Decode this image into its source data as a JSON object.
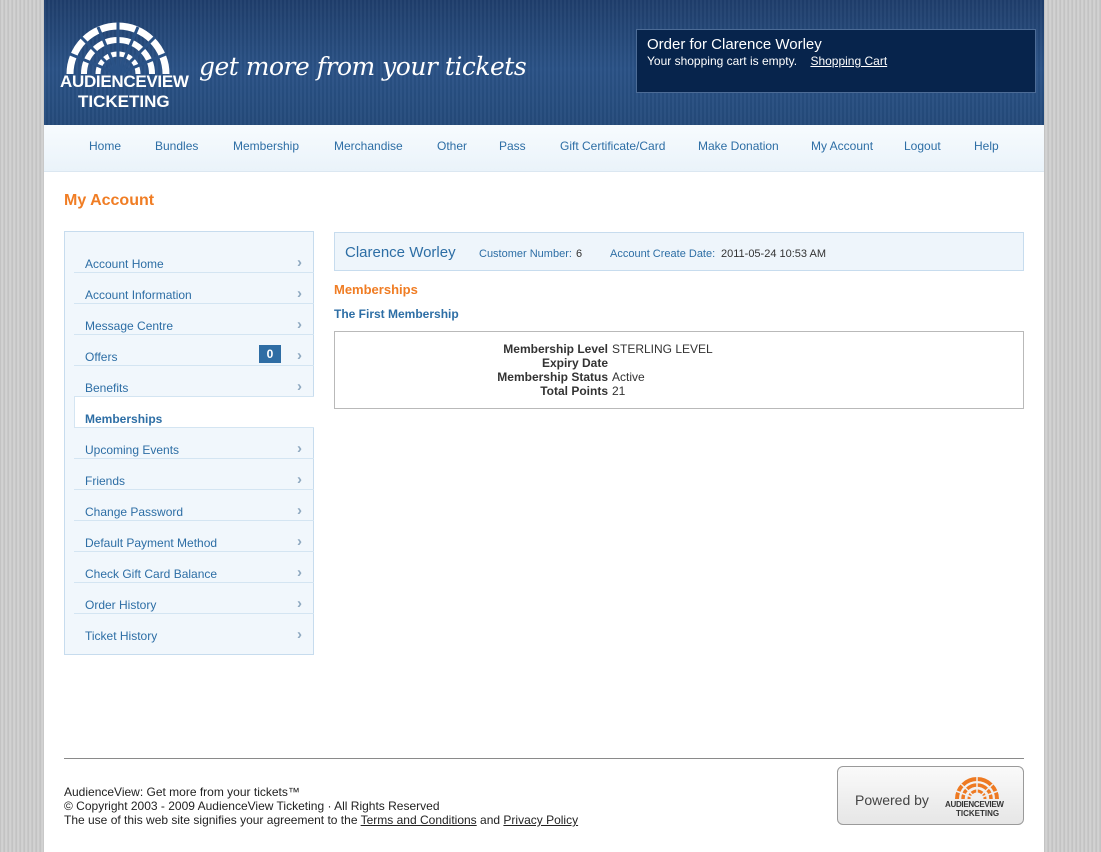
{
  "header": {
    "logo_line1": "AUDIENCEVIEW",
    "logo_line2": "TICKETING",
    "tagline": "get more from your tickets",
    "order_title": "Order for Clarence Worley",
    "cart_status": "Your shopping cart is empty.",
    "cart_link": "Shopping Cart"
  },
  "nav": {
    "items": [
      "Home",
      "Bundles",
      "Membership",
      "Merchandise",
      "Other",
      "Pass",
      "Gift Certificate/Card",
      "Make Donation",
      "My Account",
      "Logout",
      "Help"
    ]
  },
  "page_title": "My Account",
  "sidebar": {
    "items": [
      {
        "label": "Account Home"
      },
      {
        "label": "Account Information"
      },
      {
        "label": "Message Centre"
      },
      {
        "label": "Offers",
        "badge": "0"
      },
      {
        "label": "Benefits"
      },
      {
        "label": "Memberships",
        "active": true
      },
      {
        "label": "Upcoming Events"
      },
      {
        "label": "Friends"
      },
      {
        "label": "Change Password"
      },
      {
        "label": "Default Payment Method"
      },
      {
        "label": "Check Gift Card Balance"
      },
      {
        "label": "Order History"
      },
      {
        "label": "Ticket History"
      }
    ]
  },
  "customer": {
    "name": "Clarence Worley",
    "number_label": "Customer Number:",
    "number_value": "6",
    "create_label": "Account Create Date:",
    "create_value": "2011-05-24 10:53 AM"
  },
  "memberships": {
    "section_title": "Memberships",
    "name": "The First Membership",
    "details": [
      {
        "label": "Membership Level",
        "value": "STERLING LEVEL"
      },
      {
        "label": "Expiry Date",
        "value": ""
      },
      {
        "label": "Membership Status",
        "value": "Active"
      },
      {
        "label": "Total Points",
        "value": "21"
      }
    ]
  },
  "footer": {
    "line1": "AudienceView: Get more from your tickets™",
    "line2": "© Copyright 2003 - 2009 AudienceView Ticketing · All Rights Reserved",
    "line3_prefix": "The use of this web site signifies your agreement to the",
    "terms_link": "Terms and Conditions",
    "and_text": "and",
    "privacy_link": "Privacy Policy",
    "powered_by": "Powered by",
    "powered_logo_line1": "AUDIENCEVIEW",
    "powered_logo_line2": "TICKETING"
  },
  "colors": {
    "accent_orange": "#f07d24",
    "link_blue": "#2d6ea5",
    "header_navy": "#1f3e6c",
    "cart_box": "#07244c"
  }
}
